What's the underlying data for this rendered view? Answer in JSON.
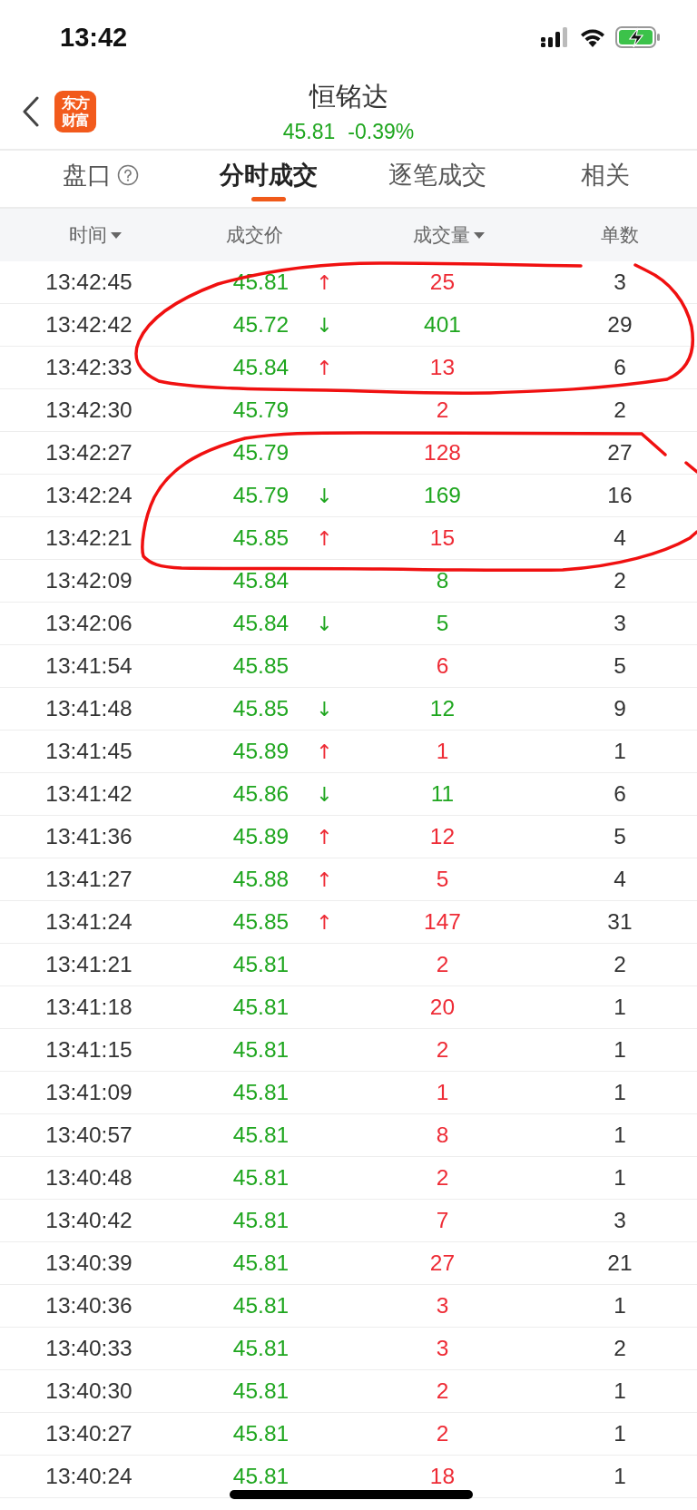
{
  "status_bar": {
    "time": "13:42"
  },
  "header": {
    "logo_lines": [
      "东方",
      "财富"
    ],
    "title": "恒铭达",
    "price": "45.81",
    "change": "-0.39%"
  },
  "tabs": [
    {
      "label": "盘口",
      "help": true,
      "selected": false
    },
    {
      "label": "分时成交",
      "help": false,
      "selected": true
    },
    {
      "label": "逐笔成交",
      "help": false,
      "selected": false
    },
    {
      "label": "相关",
      "help": false,
      "selected": false
    }
  ],
  "columns": [
    {
      "label": "时间",
      "sortable": true
    },
    {
      "label": "成交价",
      "sortable": false
    },
    {
      "label": "成交量",
      "sortable": true
    },
    {
      "label": "单数",
      "sortable": false
    }
  ],
  "rows": [
    {
      "time": "13:42:45",
      "price": "45.81",
      "arrow": "↑",
      "volume": "25",
      "buy": true,
      "count": "3"
    },
    {
      "time": "13:42:42",
      "price": "45.72",
      "arrow": "↓",
      "volume": "401",
      "buy": false,
      "count": "29"
    },
    {
      "time": "13:42:33",
      "price": "45.84",
      "arrow": "↑",
      "volume": "13",
      "buy": true,
      "count": "6"
    },
    {
      "time": "13:42:30",
      "price": "45.79",
      "volume": "2",
      "buy": true,
      "count": "2"
    },
    {
      "time": "13:42:27",
      "price": "45.79",
      "volume": "128",
      "buy": true,
      "count": "27"
    },
    {
      "time": "13:42:24",
      "price": "45.79",
      "arrow": "↓",
      "volume": "169",
      "buy": false,
      "count": "16"
    },
    {
      "time": "13:42:21",
      "price": "45.85",
      "arrow": "↑",
      "volume": "15",
      "buy": true,
      "count": "4"
    },
    {
      "time": "13:42:09",
      "price": "45.84",
      "volume": "8",
      "buy": false,
      "count": "2"
    },
    {
      "time": "13:42:06",
      "price": "45.84",
      "arrow": "↓",
      "volume": "5",
      "buy": false,
      "count": "3"
    },
    {
      "time": "13:41:54",
      "price": "45.85",
      "volume": "6",
      "buy": true,
      "count": "5"
    },
    {
      "time": "13:41:48",
      "price": "45.85",
      "arrow": "↓",
      "volume": "12",
      "buy": false,
      "count": "9"
    },
    {
      "time": "13:41:45",
      "price": "45.89",
      "arrow": "↑",
      "volume": "1",
      "buy": true,
      "count": "1"
    },
    {
      "time": "13:41:42",
      "price": "45.86",
      "arrow": "↓",
      "volume": "11",
      "buy": false,
      "count": "6"
    },
    {
      "time": "13:41:36",
      "price": "45.89",
      "arrow": "↑",
      "volume": "12",
      "buy": true,
      "count": "5"
    },
    {
      "time": "13:41:27",
      "price": "45.88",
      "arrow": "↑",
      "volume": "5",
      "buy": true,
      "count": "4"
    },
    {
      "time": "13:41:24",
      "price": "45.85",
      "arrow": "↑",
      "volume": "147",
      "buy": true,
      "count": "31"
    },
    {
      "time": "13:41:21",
      "price": "45.81",
      "volume": "2",
      "buy": true,
      "count": "2"
    },
    {
      "time": "13:41:18",
      "price": "45.81",
      "volume": "20",
      "buy": true,
      "count": "1"
    },
    {
      "time": "13:41:15",
      "price": "45.81",
      "volume": "2",
      "buy": true,
      "count": "1"
    },
    {
      "time": "13:41:09",
      "price": "45.81",
      "volume": "1",
      "buy": true,
      "count": "1"
    },
    {
      "time": "13:40:57",
      "price": "45.81",
      "volume": "8",
      "buy": true,
      "count": "1"
    },
    {
      "time": "13:40:48",
      "price": "45.81",
      "volume": "2",
      "buy": true,
      "count": "1"
    },
    {
      "time": "13:40:42",
      "price": "45.81",
      "volume": "7",
      "buy": true,
      "count": "3"
    },
    {
      "time": "13:40:39",
      "price": "45.81",
      "volume": "27",
      "buy": true,
      "count": "21"
    },
    {
      "time": "13:40:36",
      "price": "45.81",
      "volume": "3",
      "buy": true,
      "count": "1"
    },
    {
      "time": "13:40:33",
      "price": "45.81",
      "volume": "3",
      "buy": true,
      "count": "2"
    },
    {
      "time": "13:40:30",
      "price": "45.81",
      "volume": "2",
      "buy": true,
      "count": "1"
    },
    {
      "time": "13:40:27",
      "price": "45.81",
      "volume": "2",
      "buy": true,
      "count": "1"
    },
    {
      "time": "13:40:24",
      "price": "45.81",
      "volume": "18",
      "buy": true,
      "count": "1"
    }
  ]
}
